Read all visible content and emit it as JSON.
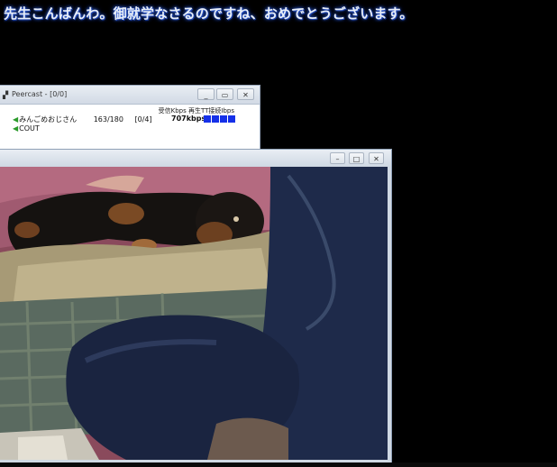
{
  "subtitle": "先生こんばんわ。御就学なさるのですね、おめでとうございます。",
  "peercast": {
    "title": "Peercast - [0/0]",
    "app_icon": "signal-icon",
    "controls": {
      "minimize": "_",
      "restore": "▭",
      "close": "✕"
    },
    "stats": "受信Kbps 再生TT接続Ibps",
    "rows": [
      {
        "icon": "green-arrow-icon",
        "name": "みんごめおじさん",
        "listeners": "163/180",
        "relay": "[0/4]"
      },
      {
        "icon": "green-arrow-icon",
        "name": "COUT",
        "listeners": "",
        "relay": ""
      }
    ],
    "bitrate": "707kbps",
    "status_bars": 4,
    "bar_color": "#1530e8"
  },
  "video": {
    "controls": {
      "minimize": "–",
      "restore": "□",
      "close": "✕"
    }
  }
}
